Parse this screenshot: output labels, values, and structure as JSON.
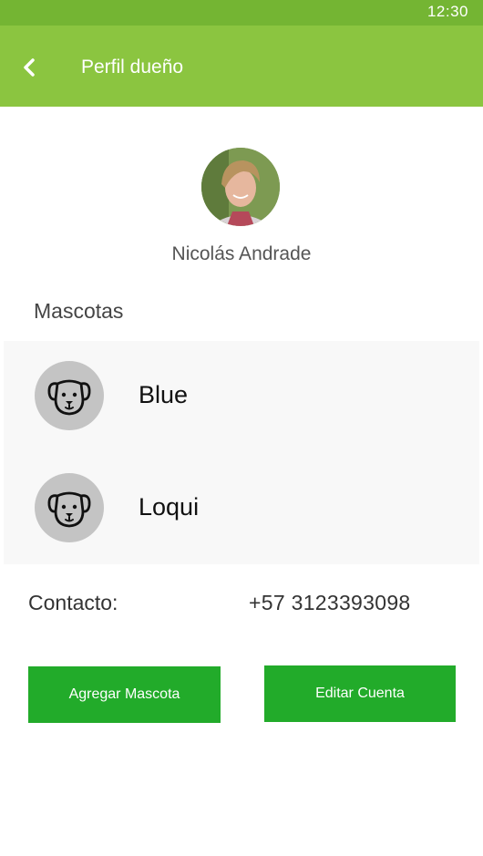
{
  "status_bar": {
    "time": "12:30"
  },
  "app_bar": {
    "title": "Perfil dueño",
    "back_icon": "chevron-left-icon"
  },
  "profile": {
    "name": "Nicolás Andrade"
  },
  "pets": {
    "section_title": "Mascotas",
    "items": [
      {
        "name": "Blue",
        "icon": "dog-icon"
      },
      {
        "name": "Loqui",
        "icon": "dog-icon"
      }
    ]
  },
  "contact": {
    "label": "Contacto:",
    "value": "+57 3123393098"
  },
  "actions": {
    "add_pet": "Agregar Mascota",
    "edit_account": "Editar Cuenta"
  },
  "colors": {
    "status_bar": "#74b533",
    "app_bar": "#8bc540",
    "button": "#22ab2a",
    "pet_icon_bg": "#c4c4c4",
    "list_bg": "#f8f8f8"
  }
}
